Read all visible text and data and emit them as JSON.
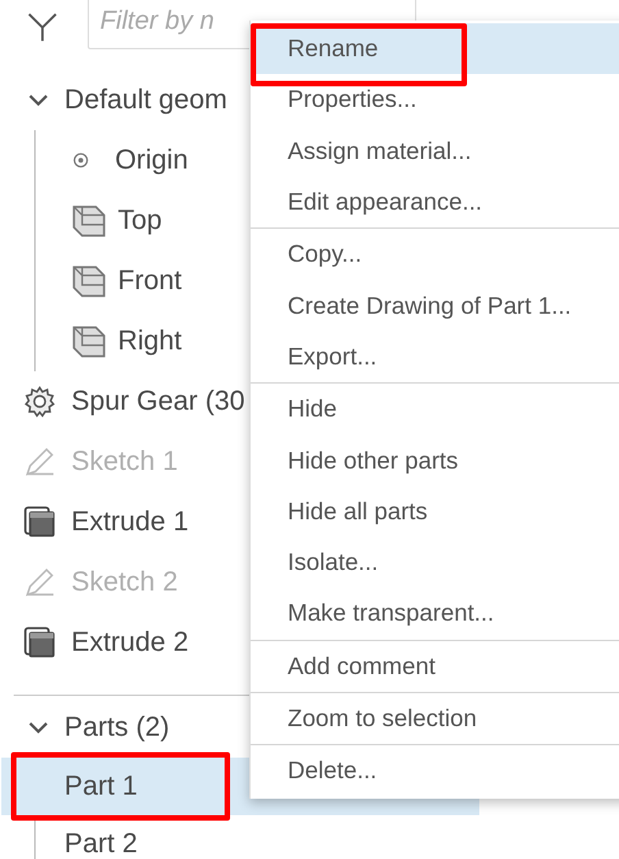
{
  "filter": {
    "placeholder": "Filter by n"
  },
  "tree": [
    {
      "kind": "group",
      "label": "Default geom",
      "expanded": true,
      "children": [
        {
          "kind": "origin",
          "label": "Origin"
        },
        {
          "kind": "plane",
          "label": "Top"
        },
        {
          "kind": "plane",
          "label": "Front"
        },
        {
          "kind": "plane",
          "label": "Right"
        }
      ]
    },
    {
      "kind": "gear",
      "label": "Spur Gear (30",
      "disabled": false
    },
    {
      "kind": "sketch",
      "label": "Sketch 1",
      "disabled": true
    },
    {
      "kind": "extrude",
      "label": "Extrude 1",
      "disabled": false
    },
    {
      "kind": "sketch",
      "label": "Sketch 2",
      "disabled": true
    },
    {
      "kind": "extrude",
      "label": "Extrude 2",
      "disabled": false
    }
  ],
  "parts": {
    "label": "Parts (2)",
    "expanded": true,
    "children": [
      {
        "label": "Part 1",
        "selected": true,
        "annotated": true
      },
      {
        "label": "Part 2",
        "selected": false,
        "annotated": false
      }
    ]
  },
  "context_menu": {
    "sections": [
      [
        {
          "label": "Rename",
          "selected": true,
          "annotated": true
        },
        {
          "label": "Properties...",
          "selected": false,
          "annotated": false
        },
        {
          "label": "Assign material...",
          "selected": false,
          "annotated": false
        },
        {
          "label": "Edit appearance...",
          "selected": false,
          "annotated": false
        }
      ],
      [
        {
          "label": "Copy...",
          "selected": false,
          "annotated": false
        },
        {
          "label": "Create Drawing of Part 1...",
          "selected": false,
          "annotated": false
        },
        {
          "label": "Export...",
          "selected": false,
          "annotated": false
        }
      ],
      [
        {
          "label": "Hide",
          "selected": false,
          "annotated": false
        },
        {
          "label": "Hide other parts",
          "selected": false,
          "annotated": false
        },
        {
          "label": "Hide all parts",
          "selected": false,
          "annotated": false
        },
        {
          "label": "Isolate...",
          "selected": false,
          "annotated": false
        },
        {
          "label": "Make transparent...",
          "selected": false,
          "annotated": false
        }
      ],
      [
        {
          "label": "Add comment",
          "selected": false,
          "annotated": false
        }
      ],
      [
        {
          "label": "Zoom to selection",
          "selected": false,
          "annotated": false
        }
      ],
      [
        {
          "label": "Delete...",
          "selected": false,
          "annotated": false
        }
      ]
    ]
  }
}
